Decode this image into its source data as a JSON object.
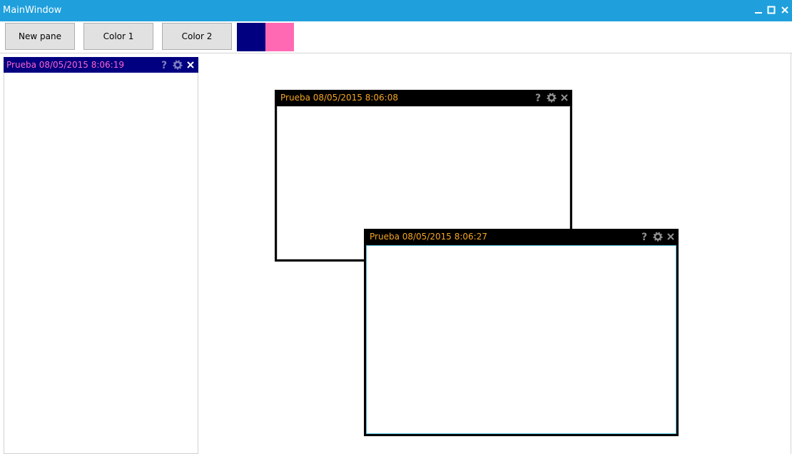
{
  "window": {
    "title": "MainWindow"
  },
  "toolbar": {
    "new_pane_label": "New pane",
    "color1_label": "Color 1",
    "color2_label": "Color 2",
    "color1_value": "#000080",
    "color2_value": "#ff69b4"
  },
  "panes": {
    "docked": {
      "title": "Prueba 08/05/2015 8:06:19",
      "title_color": "#ff66cc",
      "header_color": "#000080"
    },
    "floating_1": {
      "title": "Prueba 08/05/2015 8:06:08",
      "title_color": "#f5a623"
    },
    "floating_2": {
      "title": "Prueba 08/05/2015 8:06:27",
      "title_color": "#f5a623"
    }
  },
  "icons": {
    "help": "help-icon",
    "settings": "gear-icon",
    "close": "close-icon",
    "minimize": "minimize-icon",
    "maximize": "maximize-icon"
  },
  "colors": {
    "titlebar": "#1fa0dc",
    "pane_frame": "#000000"
  }
}
